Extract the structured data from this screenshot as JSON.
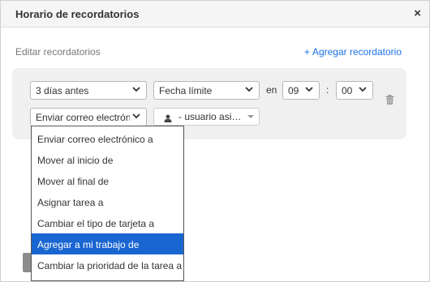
{
  "dialog": {
    "title": "Horario de recordatorios",
    "close_label": "×"
  },
  "section": {
    "label": "Editar recordatorios",
    "add_link_plus": "+",
    "add_link_label": "Agregar recordatorio"
  },
  "reminder": {
    "offset_value": "3 días antes",
    "reference_value": "Fecha límite",
    "at_label": "en",
    "hour_value": "09",
    "time_separator": ":",
    "minute_value": "00",
    "action_value": "Enviar correo electrónico a",
    "user_value": "- usuario asi…"
  },
  "action_menu": {
    "selected_index": 5,
    "options": [
      "Enviar correo electrónico a",
      "Mover al inicio de",
      "Mover al final de",
      "Asignar tarea a",
      "Cambiar el tipo de tarjeta a",
      "Agregar a mi trabajo de",
      "Cambiar la prioridad de la tarea a"
    ]
  },
  "colors": {
    "accent": "#1a73e8",
    "selected_bg": "#1a66d1",
    "panel_bg": "#f0f0f0"
  },
  "icons": {
    "close": "close-icon",
    "dropdown": "chevron-down-icon",
    "delete": "trash-icon",
    "user": "user-icon",
    "caret": "caret-down-icon"
  }
}
